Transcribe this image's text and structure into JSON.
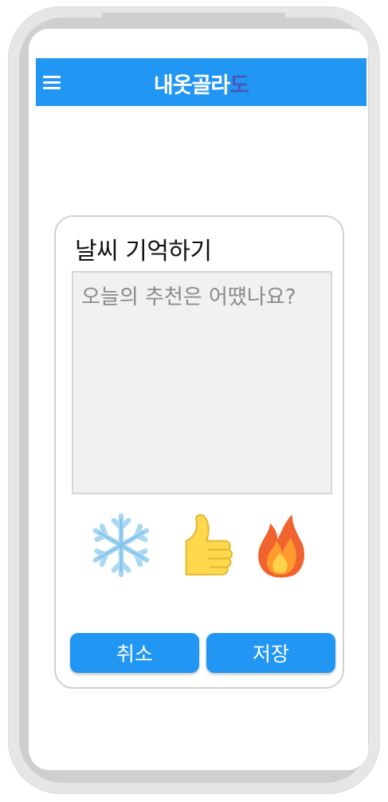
{
  "app": {
    "title_main": "내옷골라",
    "title_accent": "도",
    "accent_color": "#4a56b8",
    "primary_color": "#2196f3"
  },
  "card": {
    "title": "날씨 기억하기",
    "memo": {
      "placeholder": "오늘의 추천은 어떘나요?",
      "value": ""
    },
    "weather_icons": [
      "snowflake-icon",
      "thumbs-up-icon",
      "fire-icon"
    ],
    "buttons": {
      "cancel_label": "취소",
      "save_label": "저장"
    }
  }
}
